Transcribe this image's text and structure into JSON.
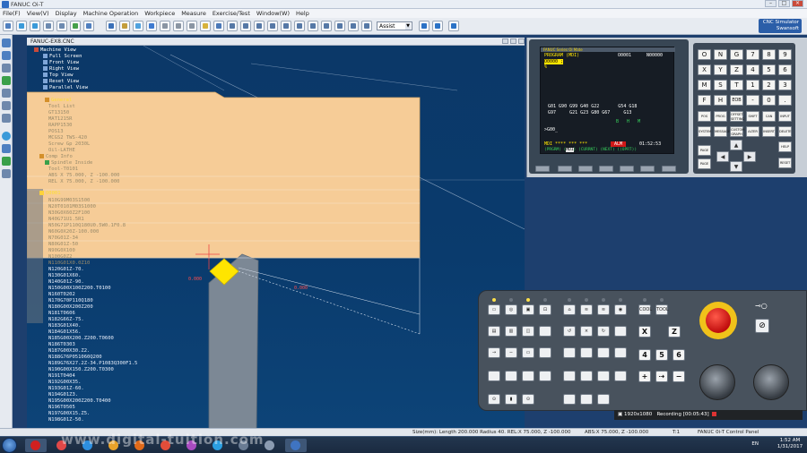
{
  "window": {
    "title": "FANUC Oi-T"
  },
  "menu": [
    "File(F)",
    "View(V)",
    "Display",
    "Machine Operation",
    "Workpiece",
    "Measure",
    "Exercise/Test",
    "Window(W)",
    "Help"
  ],
  "toolbar": {
    "assist_select": "Assist",
    "logo_line1": "CNC Simulator",
    "logo_line2": "Swansoft"
  },
  "view": {
    "title": "FANUC-EX8.CNC",
    "tree": [
      "Machine View",
      "Full Screen",
      "Front View",
      "Right View",
      "Top View",
      "Reset View",
      "Parallel View",
      "General",
      "Tool List",
      "GT13150",
      "MAT1215R",
      "RAPP1530",
      "POS13",
      "MCGS2 TWS-420",
      "Screw Gp 2030L",
      "Oil-LATHE",
      "Comp Info",
      "Spindle Inside",
      "Tool-T0101",
      "ABS X  75.000, Z -100.000",
      "REL X  75.000, Z -100.000",
      "O0001",
      "N10G99M03S1500",
      "N20T0101M03S1000",
      "N30G0X60Z2F100",
      "N40G71U1.5R1",
      "N50G71P110Q180U0.5W0.1F0.8",
      "N60G0X20Z-100.000",
      "N70G01Z-34",
      "N80G01Z-50",
      "N90G0X100",
      "N100G0Z2",
      "N110G01X0.0Z10",
      "N120G01Z-70.",
      "N130G01X60.",
      "N140G01Z-90.",
      "N150G00X100Z200.T0100",
      "N160T0202",
      "N170G70P110Q180",
      "N180G00X200Z200",
      "N181T0606",
      "N182G66Z-75.",
      "N183G01X40.",
      "N184G01X56.",
      "N185G00X200.Z200.T0600",
      "N186T0303",
      "N187G00X30.Z2.",
      "N188G76P051060Q200",
      "N189G76X27.2Z-34.P1083Q300F1.5",
      "N190G00X150.Z200.T0300",
      "N191T0404",
      "N192G00X35.",
      "N193G01Z-60.",
      "N194G01Z3.",
      "N195G00X200Z200.T0400",
      "N196T0505",
      "N197G00X15.Z5.",
      "N198G01Z-50."
    ],
    "annotations": [
      "0.000",
      "0.000"
    ]
  },
  "cnc": {
    "screen_header": "FANUC Series Oi Mate",
    "title": "PROGRAM (MDI)",
    "prog_no": "O0001",
    "seq_no": "N00000",
    "program_line": "O0000 ;",
    "cursor_line": "%",
    "modal_row1": [
      "G01",
      "G90",
      "G99",
      "G40",
      "G22",
      "",
      "G54",
      "G18"
    ],
    "modal_row2": [
      "G97",
      "",
      "G21",
      "G23",
      "G80",
      "G67",
      "",
      "G13"
    ],
    "modal_extra": [
      "B",
      "H",
      "M"
    ],
    "input_line": ">G00_",
    "mode": "MDI **** ***    ***",
    "alarm": "ALM",
    "time": "01:52:53",
    "softkeys": [
      "PRGRM",
      "MDI",
      "CURRNT",
      "NEXT",
      "(OPRT)"
    ]
  },
  "keys": {
    "alpha": [
      [
        "O",
        "N",
        "G",
        "7",
        "8",
        "9"
      ],
      [
        "X",
        "Y",
        "Z",
        "4",
        "5",
        "6"
      ],
      [
        "M",
        "S",
        "T",
        "1",
        "2",
        "3"
      ],
      [
        "F",
        "H",
        "EOB",
        "-",
        "0",
        "."
      ]
    ],
    "function": [
      [
        "POS",
        "PROG",
        "OFFSET SETTING",
        "SHIFT",
        "CAN",
        "INPUT"
      ],
      [
        "SYSTEM",
        "MESSAGE",
        "CUSTOM GRAPH",
        "ALTER",
        "INSERT",
        "DELETE"
      ]
    ],
    "page_up": "PAGE",
    "page_down": "PAGE",
    "help": "HELP",
    "reset": "RESET"
  },
  "machine_panel": {
    "keys_text": [
      "COOL",
      "TOOL",
      "X",
      "Z",
      "4",
      "5",
      "6"
    ],
    "recording_text": "1920x1080",
    "recording_label": "Recording [00:05:43]"
  },
  "status": {
    "left": "Size(mm): Length 200.000 Radius 40. REL:X  75.000, Z -100.000",
    "mid": "ABS:X  75.000, Z -100.000",
    "tool": "T:1",
    "panel": "FANUC 0i-T Control Panel"
  },
  "taskbar": {
    "lang": "EN",
    "time": "1:52 AM",
    "date": "1/31/2017"
  },
  "watermark": "www.digital-tuition.com"
}
